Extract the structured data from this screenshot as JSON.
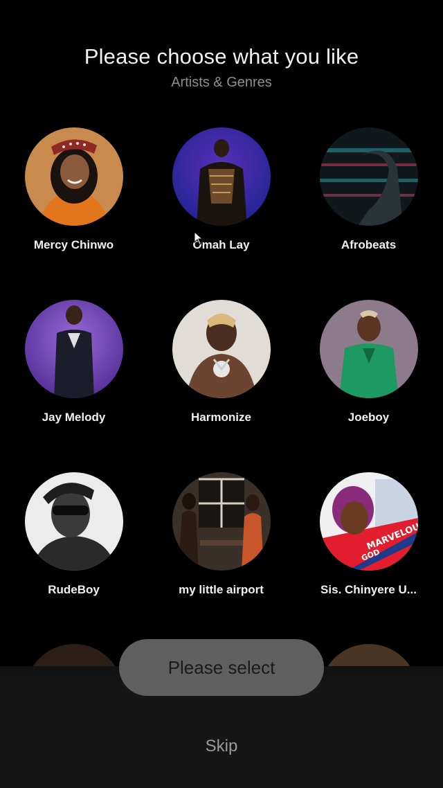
{
  "header": {
    "title": "Please choose what you like",
    "subtitle": "Artists & Genres"
  },
  "items": [
    {
      "label": "Mercy Chinwo",
      "bg": "#c7742a",
      "accent": "#e97f25"
    },
    {
      "label": "Omah Lay",
      "bg": "#2d2fa3",
      "accent": "#7b2fae"
    },
    {
      "label": "Afrobeats",
      "bg": "#1b2e33",
      "accent": "#2fa8b5"
    },
    {
      "label": "Jay Melody",
      "bg": "#6a35b8",
      "accent": "#9a6ad8"
    },
    {
      "label": "Harmonize",
      "bg": "#d9d4cf",
      "accent": "#3a2a22"
    },
    {
      "label": "Joeboy",
      "bg": "#8b6f86",
      "accent": "#1fa66a"
    },
    {
      "label": "RudeBoy",
      "bg": "#e8e8e8",
      "accent": "#333333"
    },
    {
      "label": "my little airport",
      "bg": "#3c3530",
      "accent": "#c55a2a"
    },
    {
      "label": "Sis. Chinyere U...",
      "bg": "#f2f2f2",
      "accent": "#c0306e"
    }
  ],
  "footer": {
    "select_label": "Please select",
    "skip_label": "Skip"
  }
}
